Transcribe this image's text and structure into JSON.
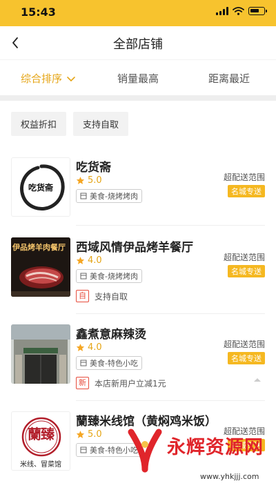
{
  "status_bar": {
    "time": "15:43",
    "background": "#f7c32e"
  },
  "nav": {
    "title": "全部店铺",
    "back_icon": "chevron-left-icon"
  },
  "sort_tabs": [
    {
      "label": "综合排序",
      "active": true
    },
    {
      "label": "销量最高",
      "active": false
    },
    {
      "label": "距离最近",
      "active": false
    }
  ],
  "filters": [
    "权益折扣",
    "支持自取"
  ],
  "shops": [
    {
      "name": "吃货斋",
      "rating": "5.0",
      "category": "美食-烧烤烤肉",
      "range_label": "超配送范围",
      "delivery": "名城专送",
      "logo_text": "吃货斋"
    },
    {
      "name": "西域风情伊品烤羊餐厅",
      "rating": "4.0",
      "category": "美食-烧烤烤肉",
      "range_label": "超配送范围",
      "delivery": "名城专送",
      "logo_text": "伊品烤羊肉餐厅",
      "promo_tag": "自",
      "promo_text": "支持自取"
    },
    {
      "name": "鑫煮意麻辣烫",
      "rating": "4.0",
      "category": "美食-特色小吃",
      "range_label": "超配送范围",
      "delivery": "名城专送",
      "promo_tag": "新",
      "promo_text": "本店新用户立减1元"
    },
    {
      "name": "蘭臻米线馆（黄焖鸡米饭）",
      "rating": "5.0",
      "category": "美食-特色小吃",
      "range_label": "超配送范围",
      "delivery": "名城专送",
      "logo_text": "蘭臻",
      "logo_sub": "米线、冒菜馆"
    }
  ],
  "watermark": {
    "text": "永辉资源网",
    "url": "www.yhkjjj.com"
  },
  "colors": {
    "accent": "#e5a516",
    "badge": "#f5b821",
    "promo": "#e74c3c"
  }
}
